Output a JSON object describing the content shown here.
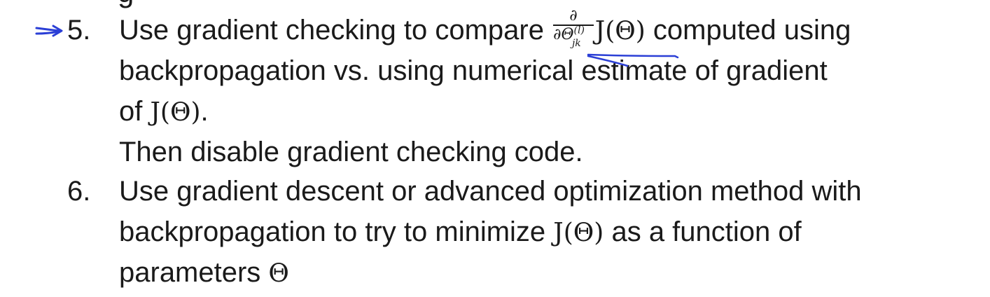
{
  "heading_fragment": "g",
  "items": [
    {
      "number": "5.",
      "lines": [
        {
          "before": "Use gradient checking to compare ",
          "frac_num": "∂",
          "frac_den": "∂Θ",
          "frac_sup": "(l)",
          "frac_sub": "jk",
          "math": "J(Θ)",
          "after": " computed using"
        },
        {
          "text": "backpropagation vs. using  numerical estimate of gradient"
        },
        {
          "before": "of ",
          "math": "J(Θ)",
          "after": "."
        },
        {
          "text": "Then disable gradient checking code."
        }
      ]
    },
    {
      "number": "6.",
      "lines": [
        {
          "text": "Use gradient descent or advanced optimization method with"
        },
        {
          "before": "backpropagation to try to  minimize ",
          "math": "J(Θ)",
          "after": " as a function of"
        },
        {
          "before": "parameters ",
          "math": "Θ"
        }
      ]
    }
  ],
  "annotation_color": "#2b3fd6"
}
